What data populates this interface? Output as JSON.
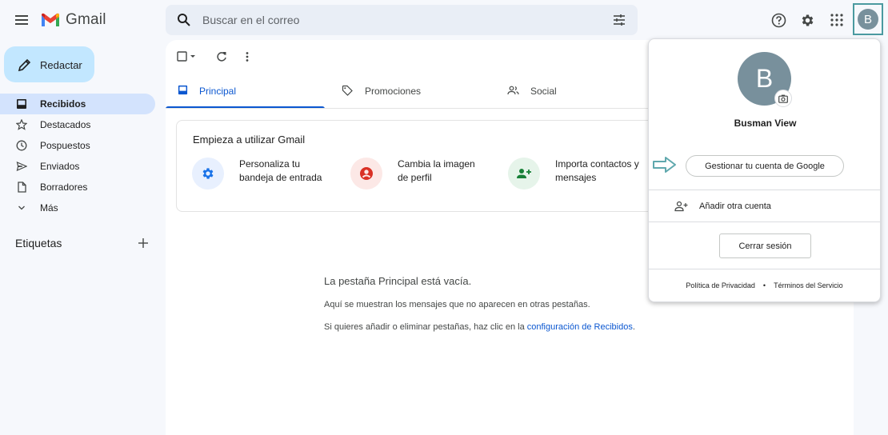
{
  "app": {
    "name": "Gmail"
  },
  "search": {
    "placeholder": "Buscar en el correo"
  },
  "header": {
    "avatar_letter": "B"
  },
  "sidebar": {
    "compose_label": "Redactar",
    "items": [
      {
        "label": "Recibidos",
        "icon": "inbox-icon"
      },
      {
        "label": "Destacados",
        "icon": "star-icon"
      },
      {
        "label": "Pospuestos",
        "icon": "clock-icon"
      },
      {
        "label": "Enviados",
        "icon": "send-icon"
      },
      {
        "label": "Borradores",
        "icon": "draft-icon"
      },
      {
        "label": "Más",
        "icon": "chevron-down-icon"
      }
    ],
    "labels_heading": "Etiquetas"
  },
  "tabs": [
    {
      "label": "Principal",
      "icon": "inbox-icon"
    },
    {
      "label": "Promociones",
      "icon": "tag-icon"
    },
    {
      "label": "Social",
      "icon": "people-icon"
    }
  ],
  "get_started": {
    "title": "Empieza a utilizar Gmail",
    "items": [
      {
        "text": "Personaliza tu bandeja de entrada",
        "icon": "gear-icon"
      },
      {
        "text": "Cambia la imagen de perfil",
        "icon": "account-icon"
      },
      {
        "text": "Importa contactos y mensajes",
        "icon": "add-person-icon"
      }
    ]
  },
  "empty_state": {
    "title": "La pestaña Principal está vacía.",
    "line1": "Aquí se muestran los mensajes que no aparecen en otras pestañas.",
    "line2_prefix": "Si quieres añadir o eliminar pestañas, haz clic en la",
    "line2_link": "configuración de Recibidos",
    "line2_suffix": "."
  },
  "account_popup": {
    "avatar_letter": "B",
    "name": "Busman View",
    "manage_label": "Gestionar tu cuenta de Google",
    "add_account_label": "Añadir otra cuenta",
    "signout_label": "Cerrar sesión",
    "privacy_label": "Política de Privacidad",
    "separator": "•",
    "terms_label": "Términos del Servicio"
  },
  "colors": {
    "compose_bg": "#c2e7ff",
    "active_nav_bg": "#d3e3fd",
    "accent_blue": "#0b57d0",
    "avatar_bg": "#78909c",
    "highlight_teal": "#4b9aa0"
  }
}
